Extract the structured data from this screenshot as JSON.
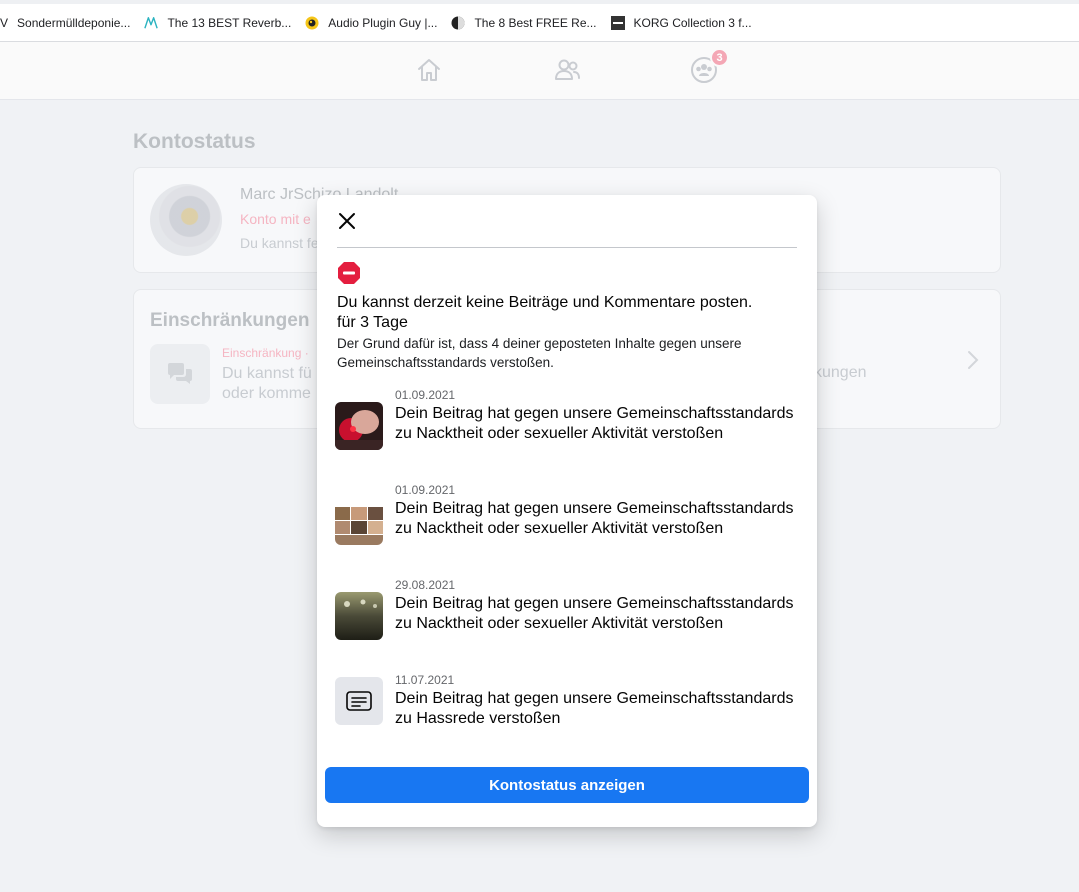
{
  "bookmarks": [
    {
      "prefix": "V",
      "label": "Sondermülldeponie..."
    },
    {
      "label": "The 13 BEST Reverb..."
    },
    {
      "label": "Audio Plugin Guy |..."
    },
    {
      "label": "The 8 Best FREE Re..."
    },
    {
      "label": "KORG Collection 3 f..."
    }
  ],
  "nav": {
    "icons": [
      "home-icon",
      "friends-icon",
      "groups-icon"
    ],
    "badge_count": "3"
  },
  "background": {
    "page_title": "Kontostatus",
    "profile": {
      "name": "Marc JrSchizo Landolt",
      "status": "Konto mit e",
      "sub": "Du kannst fe"
    },
    "restrictions": {
      "title": "Einschränkungen",
      "label": "Einschränkung ·",
      "text_line1": "Du kannst fü",
      "text_line2": "oder komme",
      "text_tail": "kungen"
    }
  },
  "modal": {
    "headline_line1": "Du kannst derzeit keine Beiträge und Kommentare posten.",
    "headline_line2": "für 3 Tage",
    "reason": "Der Grund dafür ist, dass 4 deiner geposteten Inhalte gegen unsere Gemeinschaftsstandards verstoßen.",
    "violations": [
      {
        "date": "01.09.2021",
        "text": "Dein Beitrag hat gegen unsere Gemeinschaftsstandards zu Nacktheit oder sexueller Aktivität verstoßen",
        "thumb": "photo-red"
      },
      {
        "date": "01.09.2021",
        "text": "Dein Beitrag hat gegen unsere Gemeinschaftsstandards zu Nacktheit oder sexueller Aktivität verstoßen",
        "thumb": "photo-grid"
      },
      {
        "date": "29.08.2021",
        "text": "Dein Beitrag hat gegen unsere Gemeinschaftsstandards zu Nacktheit oder sexueller Aktivität verstoßen",
        "thumb": "photo-dark"
      },
      {
        "date": "11.07.2021",
        "text": "Dein Beitrag hat gegen unsere Gemeinschaftsstandards zu Hassrede verstoßen",
        "thumb": "text-post-icon"
      }
    ],
    "button_label": "Kontostatus anzeigen"
  },
  "colors": {
    "accent": "#1877f2",
    "stop_red": "#e41e3f",
    "badge": "#f4a7b5"
  }
}
